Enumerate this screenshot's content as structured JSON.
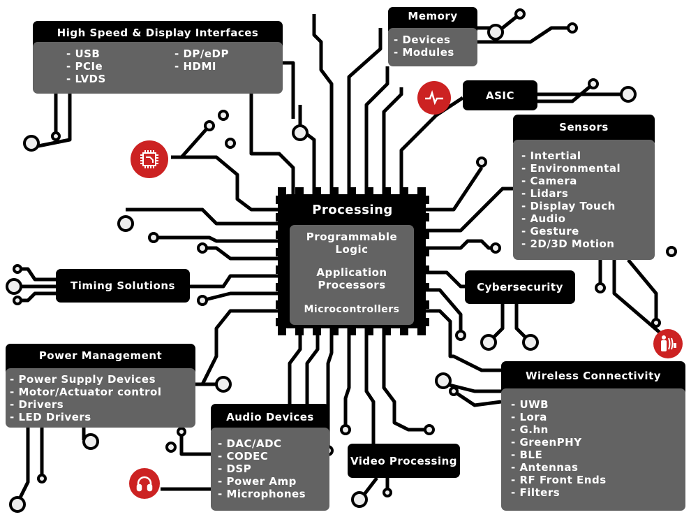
{
  "center": {
    "title": "Processing",
    "items": [
      "Programmable Logic",
      "Application Processors",
      "Microcontrollers"
    ]
  },
  "high_speed": {
    "title": "High Speed & Display Interfaces",
    "col1": [
      "- USB",
      "- PCIe",
      "- LVDS"
    ],
    "col2": [
      "- DP/eDP",
      "- HDMI"
    ]
  },
  "memory": {
    "title": "Memory",
    "items": [
      "- Devices",
      "- Modules"
    ]
  },
  "asic": {
    "title": "ASIC"
  },
  "sensors": {
    "title": "Sensors",
    "items": [
      "- Intertial",
      "- Environmental",
      "- Camera",
      "- Lidars",
      "- Display Touch",
      "- Audio",
      "- Gesture",
      "- 2D/3D Motion"
    ]
  },
  "timing": {
    "title": "Timing Solutions"
  },
  "cybersecurity": {
    "title": "Cybersecurity"
  },
  "power": {
    "title": "Power Management",
    "items": [
      "- Power Supply Devices",
      "- Motor/Actuator control",
      "- Drivers",
      "- LED Drivers"
    ]
  },
  "audio": {
    "title": "Audio Devices",
    "items": [
      "- DAC/ADC",
      "- CODEC",
      "- DSP",
      "- Power Amp",
      "- Microphones"
    ]
  },
  "video": {
    "title": "Video Processing"
  },
  "wireless": {
    "title": "Wireless Connectivity",
    "items": [
      "- UWB",
      "- Lora",
      "- G.hn",
      "- GreenPHY",
      "- BLE",
      "- Antennas",
      "- RF Front Ends",
      "- Filters"
    ]
  },
  "icons": [
    "chip-icon",
    "heartbeat-icon",
    "person-sensor-icon",
    "headphones-icon"
  ],
  "colors": {
    "box_header": "#000000",
    "box_body": "#636363",
    "accent_red": "#cc2222",
    "text": "#ffffff"
  }
}
